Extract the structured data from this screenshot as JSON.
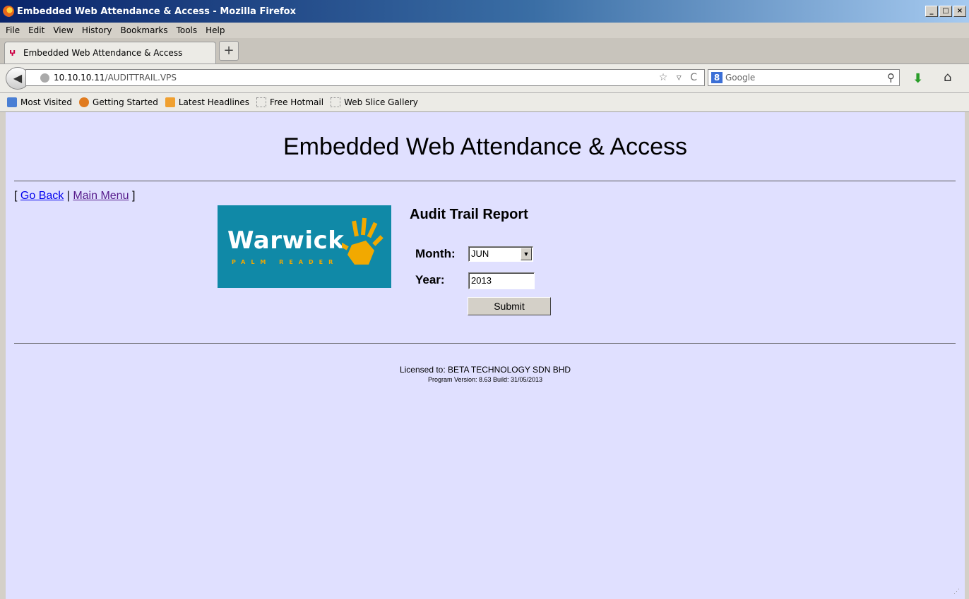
{
  "window": {
    "title": "Embedded Web Attendance & Access - Mozilla Firefox",
    "min": "_",
    "max": "□",
    "close": "×"
  },
  "menu": [
    "File",
    "Edit",
    "View",
    "History",
    "Bookmarks",
    "Tools",
    "Help"
  ],
  "tab": {
    "label": "Embedded Web Attendance & Access",
    "new_tab": "+"
  },
  "url": {
    "host": "10.10.10.11",
    "path": "/AUDITTRAIL.VPS",
    "icons": "☆ ▿ C"
  },
  "search": {
    "placeholder": "Google",
    "engine_icon": "8"
  },
  "bookmarks": [
    "Most Visited",
    "Getting Started",
    "Latest Headlines",
    "Free Hotmail",
    "Web Slice Gallery"
  ],
  "page": {
    "heading": "Embedded Web Attendance & Access",
    "nav": {
      "open": "[",
      "go_back": "Go Back",
      "sep": "|",
      "main_menu": "Main Menu",
      "close": "]"
    },
    "logo": {
      "word": "Warwick",
      "sub": "PALM READER"
    },
    "report_title": "Audit Trail Report",
    "month_label": "Month:",
    "month_value": "JUN",
    "year_label": "Year:",
    "year_value": "2013",
    "submit_label": "Submit",
    "licensed": "Licensed to:  BETA TECHNOLOGY SDN BHD",
    "version": "Program Version: 8.63   Build: 31/05/2013"
  }
}
